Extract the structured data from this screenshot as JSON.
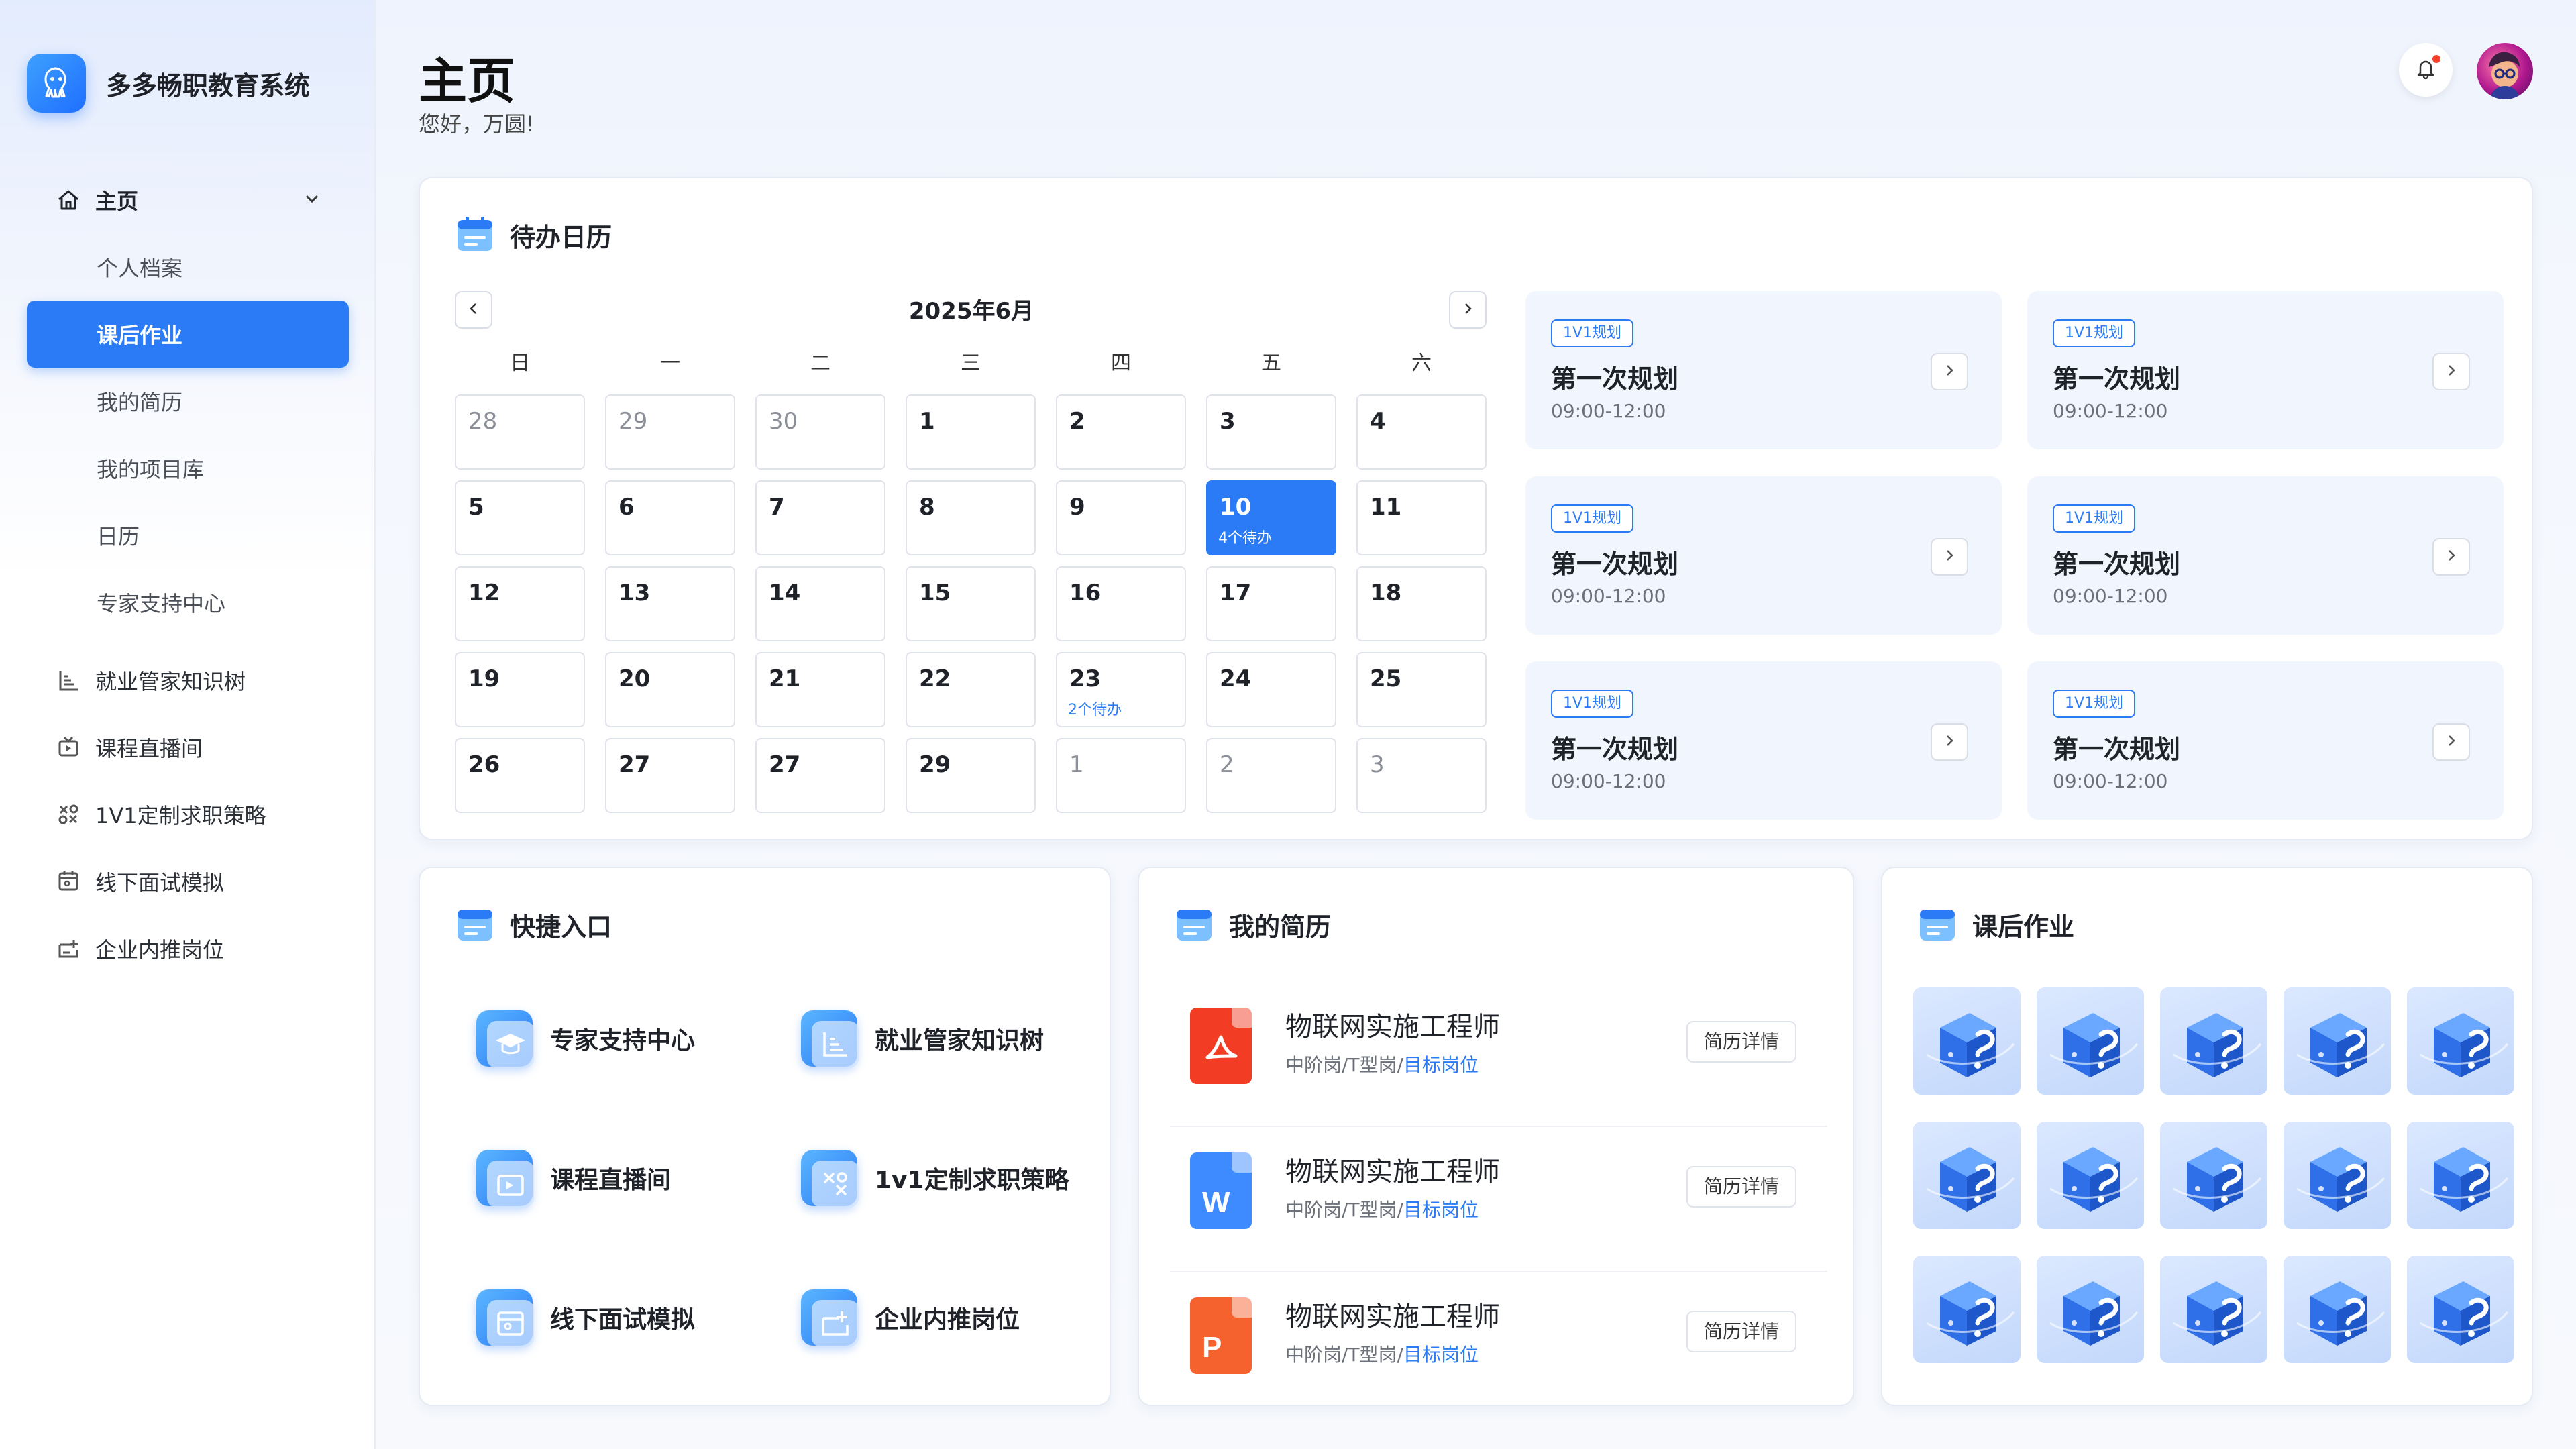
{
  "app": {
    "title": "多多畅职教育系统"
  },
  "sidebar": {
    "home": {
      "label": "主页"
    },
    "sub_items": [
      {
        "label": "个人档案"
      },
      {
        "label": "课后作业"
      },
      {
        "label": "我的简历"
      },
      {
        "label": "我的项目库"
      },
      {
        "label": "日历"
      },
      {
        "label": "专家支持中心"
      }
    ],
    "items": [
      {
        "label": "就业管家知识树",
        "icon": "knowledge-tree-icon"
      },
      {
        "label": "课程直播间",
        "icon": "live-tv-icon"
      },
      {
        "label": "1V1定制求职策略",
        "icon": "strategy-icon"
      },
      {
        "label": "线下面试模拟",
        "icon": "interview-icon"
      },
      {
        "label": "企业内推岗位",
        "icon": "referral-icon"
      }
    ]
  },
  "header": {
    "title": "主页",
    "greeting": "您好，万圆!"
  },
  "calendar": {
    "title": "待办日历",
    "month": "2025年6月",
    "weekdays": [
      "日",
      "一",
      "二",
      "三",
      "四",
      "五",
      "六"
    ],
    "days": [
      {
        "n": "28",
        "other": true
      },
      {
        "n": "29",
        "other": true
      },
      {
        "n": "30",
        "other": true
      },
      {
        "n": "1"
      },
      {
        "n": "2"
      },
      {
        "n": "3"
      },
      {
        "n": "4"
      },
      {
        "n": "5"
      },
      {
        "n": "6"
      },
      {
        "n": "7"
      },
      {
        "n": "8"
      },
      {
        "n": "9"
      },
      {
        "n": "10",
        "todo": "4个待办",
        "selected": true
      },
      {
        "n": "11"
      },
      {
        "n": "12"
      },
      {
        "n": "13"
      },
      {
        "n": "14"
      },
      {
        "n": "15"
      },
      {
        "n": "16"
      },
      {
        "n": "17"
      },
      {
        "n": "18"
      },
      {
        "n": "19"
      },
      {
        "n": "20"
      },
      {
        "n": "21"
      },
      {
        "n": "22"
      },
      {
        "n": "23",
        "todo": "2个待办"
      },
      {
        "n": "24"
      },
      {
        "n": "25"
      },
      {
        "n": "26"
      },
      {
        "n": "27"
      },
      {
        "n": "27"
      },
      {
        "n": "29"
      },
      {
        "n": "1",
        "other": true
      },
      {
        "n": "2",
        "other": true
      },
      {
        "n": "3",
        "other": true
      }
    ],
    "plans": [
      {
        "tag": "1V1规划",
        "title": "第一次规划",
        "time": "09:00-12:00"
      },
      {
        "tag": "1V1规划",
        "title": "第一次规划",
        "time": "09:00-12:00"
      },
      {
        "tag": "1V1规划",
        "title": "第一次规划",
        "time": "09:00-12:00"
      },
      {
        "tag": "1V1规划",
        "title": "第一次规划",
        "time": "09:00-12:00"
      },
      {
        "tag": "1V1规划",
        "title": "第一次规划",
        "time": "09:00-12:00"
      },
      {
        "tag": "1V1规划",
        "title": "第一次规划",
        "time": "09:00-12:00"
      }
    ]
  },
  "quick": {
    "title": "快捷入口",
    "items": [
      {
        "label": "专家支持中心",
        "icon": "expert-cap-icon"
      },
      {
        "label": "就业管家知识树",
        "icon": "knowledge-tree-icon"
      },
      {
        "label": "课程直播间",
        "icon": "live-tv-icon"
      },
      {
        "label": "1v1定制求职策略",
        "icon": "strategy-icon"
      },
      {
        "label": "线下面试模拟",
        "icon": "interview-icon"
      },
      {
        "label": "企业内推岗位",
        "icon": "referral-icon"
      }
    ]
  },
  "resume": {
    "title": "我的简历",
    "items": [
      {
        "title": "物联网实施工程师",
        "sub_prefix": "中阶岗/T型岗/",
        "sub_highlight": "目标岗位",
        "button": "简历详情",
        "file": "pdf",
        "color": "#f23c24"
      },
      {
        "title": "物联网实施工程师",
        "sub_prefix": "中阶岗/T型岗/",
        "sub_highlight": "目标岗位",
        "button": "简历详情",
        "file": "W",
        "color": "#3d8bff"
      },
      {
        "title": "物联网实施工程师",
        "sub_prefix": "中阶岗/T型岗/",
        "sub_highlight": "目标岗位",
        "button": "简历详情",
        "file": "P",
        "color": "#f5622e"
      }
    ]
  },
  "homework": {
    "title": "课后作业",
    "tile_icon": "homework-cube-icon"
  },
  "colors": {
    "accent": "#2b7bf6",
    "pdf": "#f23c24",
    "word": "#3d8bff",
    "ppt": "#f5622e"
  }
}
